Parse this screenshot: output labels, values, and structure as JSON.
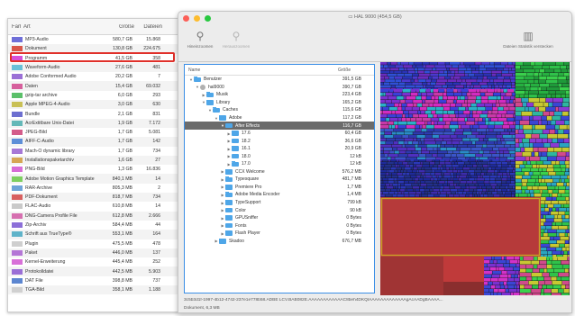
{
  "types_panel": {
    "headers": {
      "color": "Farbe",
      "kind": "Art",
      "size": "Größe",
      "files": "Dateien"
    },
    "rows": [
      {
        "color": "#6f6fd8",
        "kind": "MP3-Audio",
        "size": "580,7 GB",
        "files": "15.868"
      },
      {
        "color": "#d9574a",
        "kind": "Dokument",
        "size": "130,8 GB",
        "files": "224.675"
      },
      {
        "color": "#d84fd8",
        "kind": "Programm",
        "size": "41,5 GB",
        "files": "358"
      },
      {
        "color": "#67c0d8",
        "kind": "Waveform-Audio",
        "size": "27,6 GB",
        "files": "481"
      },
      {
        "color": "#9b70d6",
        "kind": "Adobe Conformed Audio",
        "size": "20,2 GB",
        "files": "7"
      },
      {
        "color": "#d65f9c",
        "kind": "Daten",
        "size": "15,4 GB",
        "files": "69.032"
      },
      {
        "color": "#5bc06a",
        "kind": "gzip-tar archive",
        "size": "6,0 GB",
        "files": "293"
      },
      {
        "color": "#c9c055",
        "kind": "Apple MPEG-4-Audio",
        "size": "3,0 GB",
        "files": "630"
      },
      {
        "color": "#6d6fd0",
        "kind": "Bundle",
        "size": "2,1 GB",
        "files": "831"
      },
      {
        "color": "#64b8b8",
        "kind": "AcrExtitbare Unix-Datei",
        "size": "1,9 GB",
        "files": "7.172"
      },
      {
        "color": "#d45c8a",
        "kind": "JPEG-Bild",
        "size": "1,7 GB",
        "files": "5.081"
      },
      {
        "color": "#5e8fd8",
        "kind": "AIFF-C-Audio",
        "size": "1,7 GB",
        "files": "142"
      },
      {
        "color": "#a778d6",
        "kind": "Mach-O dynamic library",
        "size": "1,7 GB",
        "files": "734"
      },
      {
        "color": "#d6a654",
        "kind": "Installationspaketarchiv",
        "size": "1,6 GB",
        "files": "27"
      },
      {
        "color": "#d86cd6",
        "kind": "PNG-Bild",
        "size": "1,3 GB",
        "files": "16.836"
      },
      {
        "color": "#7ecf60",
        "kind": "Adobe Motion Graphics Template",
        "size": "840,1 MB",
        "files": "14"
      },
      {
        "color": "#6ea4d8",
        "kind": "RAR-Archive",
        "size": "805,3 MB",
        "files": "2"
      },
      {
        "color": "#d86060",
        "kind": "PDF-Dokument",
        "size": "818,7 MB",
        "files": "734"
      },
      {
        "color": "#c9c9c9",
        "kind": "FLAC-Audio",
        "size": "610,8 MB",
        "files": "14"
      },
      {
        "color": "#d66fb0",
        "kind": "DNG-Camera Profile File",
        "size": "612,8 MB",
        "files": "2.666"
      },
      {
        "color": "#8c6fd8",
        "kind": "Zip-Archiv",
        "size": "584,4 MB",
        "files": "44"
      },
      {
        "color": "#5fb3c9",
        "kind": "Schrift aus TrueType®",
        "size": "553,1 MB",
        "files": "164"
      },
      {
        "color": "#cfcfcf",
        "kind": "Plugin",
        "size": "475,5 MB",
        "files": "478"
      },
      {
        "color": "#b476d6",
        "kind": "Paket",
        "size": "446,0 MB",
        "files": "137"
      },
      {
        "color": "#d870d8",
        "kind": "Kernel-Erweiterung",
        "size": "445,4 MB",
        "files": "252"
      },
      {
        "color": "#9a6ed6",
        "kind": "Protokolldatei",
        "size": "442,5 MB",
        "files": "5.903"
      },
      {
        "color": "#5c86d0",
        "kind": "DAT File",
        "size": "398,8 MB",
        "files": "737"
      },
      {
        "color": "#d0d0d0",
        "kind": "TGA-Bild",
        "size": "358,1 MB",
        "files": "1.188"
      }
    ]
  },
  "window": {
    "title": "HAL 9000 (454,5 GB)",
    "toolbar": {
      "scan_label": "Hineinzoomen",
      "zoom_label": "Herauszoomen",
      "export_label": "Dateien Statistik verstecken"
    }
  },
  "tree": {
    "headers": {
      "name": "Name",
      "size": "Größe"
    },
    "rows": [
      {
        "indent": 0,
        "arrow": "▼",
        "icon": "folder",
        "name": "Benutzer",
        "size": "391,5 GB"
      },
      {
        "indent": 1,
        "arrow": "▼",
        "icon": "person",
        "name": "hal9000",
        "size": "390,7 GB"
      },
      {
        "indent": 2,
        "arrow": "▶",
        "icon": "folder",
        "name": "Musik",
        "size": "223,4 GB"
      },
      {
        "indent": 2,
        "arrow": "▼",
        "icon": "folder",
        "name": "Library",
        "size": "165,2 GB"
      },
      {
        "indent": 3,
        "arrow": "▼",
        "icon": "folder",
        "name": "Caches",
        "size": "115,6 GB"
      },
      {
        "indent": 4,
        "arrow": "▼",
        "icon": "folder",
        "name": "Adobe",
        "size": "117,2 GB"
      },
      {
        "indent": 5,
        "arrow": "▼",
        "icon": "folder",
        "name": "After Effects",
        "size": "116,7 GB",
        "selected": true
      },
      {
        "indent": 6,
        "arrow": "▶",
        "icon": "folder",
        "name": "17.6",
        "size": "60,4 GB"
      },
      {
        "indent": 6,
        "arrow": "▶",
        "icon": "folder",
        "name": "18.2",
        "size": "36,6 GB"
      },
      {
        "indent": 6,
        "arrow": "▶",
        "icon": "folder",
        "name": "16.1",
        "size": "20,9 GB"
      },
      {
        "indent": 6,
        "arrow": "▶",
        "icon": "folder",
        "name": "18.0",
        "size": "12 kB"
      },
      {
        "indent": 6,
        "arrow": "▶",
        "icon": "folder",
        "name": "17.0",
        "size": "12 kB"
      },
      {
        "indent": 5,
        "arrow": "▶",
        "icon": "folder",
        "name": "CCX Welcome",
        "size": "576,2 MB"
      },
      {
        "indent": 5,
        "arrow": "▶",
        "icon": "folder",
        "name": "Typesquare",
        "size": "481,7 MB"
      },
      {
        "indent": 5,
        "arrow": "▶",
        "icon": "folder",
        "name": "Premiere Pro",
        "size": "1,7 MB"
      },
      {
        "indent": 5,
        "arrow": "▶",
        "icon": "folder",
        "name": "Adobe Media Encoder",
        "size": "1,4 MB"
      },
      {
        "indent": 5,
        "arrow": "▶",
        "icon": "folder",
        "name": "TypeSupport",
        "size": "799 kB"
      },
      {
        "indent": 5,
        "arrow": "▶",
        "icon": "folder",
        "name": "Color",
        "size": "90 kB"
      },
      {
        "indent": 5,
        "arrow": "▶",
        "icon": "folder",
        "name": "GPUSniffer",
        "size": "0 Bytes"
      },
      {
        "indent": 5,
        "arrow": "▶",
        "icon": "folder",
        "name": "Fonts",
        "size": "0 Bytes"
      },
      {
        "indent": 5,
        "arrow": "▶",
        "icon": "folder",
        "name": "Flash Player",
        "size": "0 Bytes"
      },
      {
        "indent": 4,
        "arrow": "▶",
        "icon": "folder",
        "name": "Skadoo",
        "size": "676,7 MB"
      }
    ]
  },
  "status": {
    "path": "3c5b3d1f-1997-4b12-4742-237e1e778b58.ADBE LCV.BAB082E.AAAAAAAAAAAAC8beh4DKQIAAAAAAAAAAAAAgAcAADgBAAAA...",
    "selection": "Dokument, 6,3 MB"
  },
  "colors": {
    "selection_border": "#e0302a",
    "tree_border": "#3a8ee6",
    "treemap_highlight": "#c9a227",
    "traffic_close": "#fc5f57",
    "traffic_min": "#fdbc2e",
    "traffic_max": "#28c840"
  }
}
